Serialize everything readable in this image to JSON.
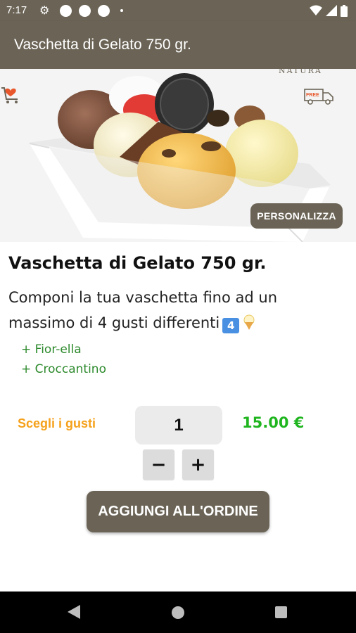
{
  "status_bar": {
    "time": "7:17"
  },
  "app_bar": {
    "title": "Vaschetta di Gelato 750 gr."
  },
  "hero": {
    "brand_text": "NATURA",
    "truck_badge": "FREE",
    "customize_label": "PERSONALIZZA"
  },
  "product": {
    "title": "Vaschetta di Gelato 750 gr.",
    "description_line1": "Componi la tua vaschetta fino ad un",
    "description_line2": "massimo di 4 gusti differenti",
    "description_badge": "4",
    "extras": [
      "+ Fior-ella",
      "+ Croccantino"
    ]
  },
  "order": {
    "choose_flavors_label": "Scegli i gusti",
    "quantity": "1",
    "price": "15.00 €",
    "minus_label": "−",
    "plus_label": "+",
    "add_button_label": "AGGIUNGI ALL'ORDINE"
  },
  "colors": {
    "brand": "#6b6456",
    "price_green": "#1fb51f",
    "accent_orange": "#f5a11b",
    "extra_green": "#2d8a2d"
  },
  "icons": [
    "settings-icon",
    "wifi-icon",
    "signal-icon",
    "battery-icon",
    "cart-heart-icon",
    "delivery-truck-icon",
    "ice-cream-icon",
    "back-icon",
    "home-icon",
    "recents-icon"
  ]
}
